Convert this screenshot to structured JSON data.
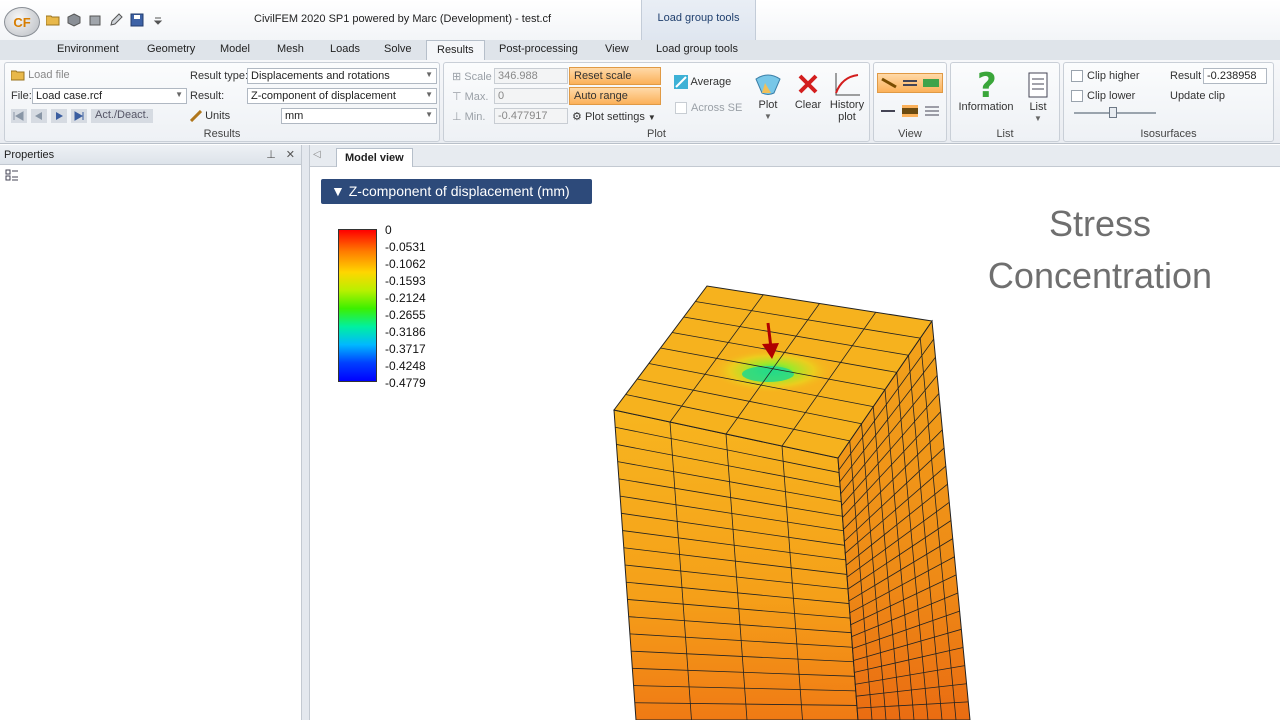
{
  "app": {
    "logo_text": "CF",
    "title": "CivilFEM 2020 SP1 powered by Marc (Development) - test.cf",
    "context_tab_header": "Load group tools"
  },
  "tabs": [
    "Environment",
    "Geometry",
    "Model",
    "Mesh",
    "Loads",
    "Solve",
    "Results",
    "Post-processing",
    "View",
    "Load group tools"
  ],
  "ribbon": {
    "results": {
      "label": "Results",
      "load_file": "Load file",
      "file_label": "File:",
      "file_value": "Load case.rcf",
      "act_deact": "Act./Deact.",
      "result_type_label": "Result type:",
      "result_type_value": "Displacements and rotations",
      "result_label": "Result:",
      "result_value": "Z-component of displacement",
      "units_label": "Units",
      "units_value": "mm"
    },
    "plot": {
      "label": "Plot",
      "scale_label": "Scale",
      "scale_value": "346.988",
      "max_label": "Max.",
      "max_value": "0",
      "min_label": "Min.",
      "min_value": "-0.477917",
      "reset_scale": "Reset scale",
      "auto_range": "Auto range",
      "plot_settings": "Plot settings",
      "average": "Average",
      "across_se": "Across SE",
      "plot_btn": "Plot",
      "clear_btn": "Clear",
      "history_plot_line1": "History",
      "history_plot_line2": "plot"
    },
    "view": {
      "label": "View"
    },
    "list": {
      "label": "List",
      "information": "Information",
      "list_btn": "List"
    },
    "isosurfaces": {
      "label": "Isosurfaces",
      "clip_higher": "Clip higher",
      "clip_lower": "Clip lower",
      "result_label": "Result",
      "result_value": "-0.238958",
      "update_clip": "Update clip"
    }
  },
  "properties_pane": {
    "title": "Properties"
  },
  "doc_tab": "Model view",
  "viewport": {
    "result_title": "Z-component of displacement (mm)",
    "legend_values": [
      "0",
      "-0.0531",
      "-0.1062",
      "-0.1593",
      "-0.2124",
      "-0.2655",
      "-0.3186",
      "-0.3717",
      "-0.4248",
      "-0.4779"
    ],
    "overlay_line1": "Stress",
    "overlay_line2": "Concentration"
  },
  "colors": {
    "accent_blue": "#2d4a7a",
    "orange_button": "#fbb15a",
    "mesh_top": "#f6b21e",
    "mesh_left": "#f5a41c",
    "mesh_right": "#ee9518"
  }
}
